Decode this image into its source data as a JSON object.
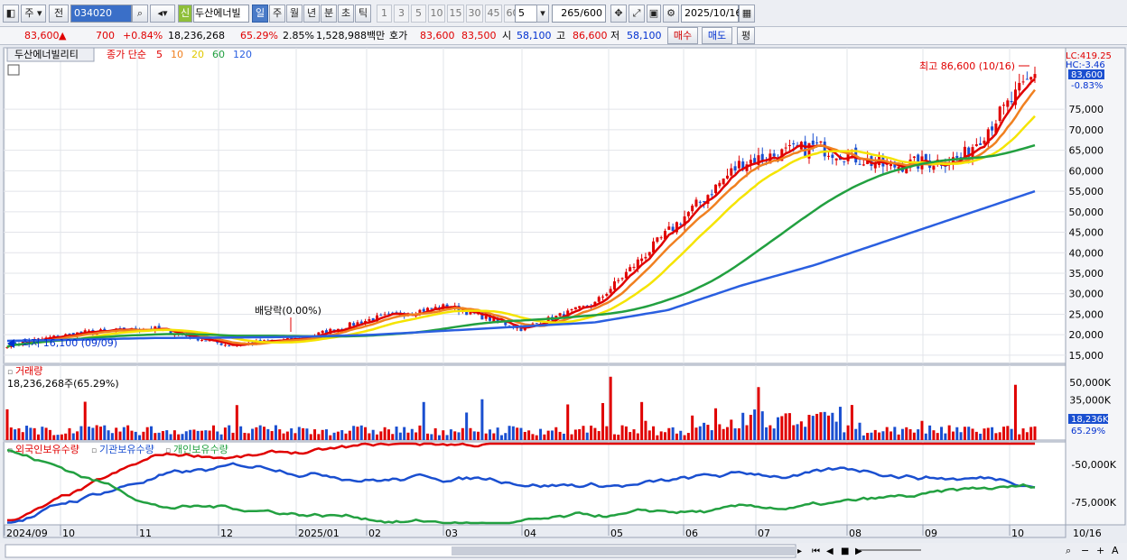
{
  "toolbar": {
    "market": "주",
    "prev_label": "전",
    "code": "034020",
    "new_badge": "신",
    "stock_name": "두산에너빌",
    "periods": [
      "일",
      "주",
      "월",
      "년",
      "분",
      "초",
      "틱"
    ],
    "active_period": "일",
    "intervals": [
      "1",
      "3",
      "5",
      "10",
      "15",
      "30",
      "45",
      "60"
    ],
    "interval_value": "5",
    "count": "265",
    "count_max": "/600",
    "date": "2025/10/16"
  },
  "quote": {
    "price": "83,600",
    "change_arrow": "▲",
    "change": "700",
    "change_pct": "+0.84%",
    "volume": "18,236,268",
    "vol_ratio": "65.29%",
    "turnover": "2.85%",
    "amount": "1,528,988백만",
    "hoga_label": "호가",
    "ask": "83,600",
    "bid": "83,500",
    "open_label": "시",
    "open": "58,100",
    "high_label": "고",
    "high": "86,600",
    "low_label": "저",
    "low": "58,100",
    "buy_label": "매수",
    "sell_label": "매도",
    "flat_label": "평"
  },
  "price_panel": {
    "title": "두산에너빌리티",
    "legend_prefix": "종가 단순",
    "ma_periods": [
      "5",
      "10",
      "20",
      "60",
      "120"
    ],
    "high_note": "최고 86,600 (10/16)",
    "low_note": "최저 16,100 (09/09)",
    "dividend_note": "배당락(0.00%)",
    "lc": "LC:419.25",
    "hc": "HC:-3.46",
    "last_price": "83,600",
    "last_pct": "-0.83%",
    "y_ticks": [
      "75,000",
      "70,000",
      "65,000",
      "60,000",
      "55,000",
      "50,000",
      "45,000",
      "40,000",
      "35,000",
      "30,000",
      "25,000",
      "20,000",
      "15,000"
    ]
  },
  "volume_panel": {
    "title": "거래량",
    "value": "18,236,268주(65.29%)",
    "y_ticks": [
      "50,000K",
      "35,000K"
    ],
    "last": "18,236K",
    "last_pct": "65.29%"
  },
  "holding_panel": {
    "series": [
      "외국인보유수량",
      "기관보유수량",
      "개인보유수량"
    ],
    "y_ticks": [
      "-50,000K",
      "-75,000K"
    ]
  },
  "x_axis": {
    "labels": [
      "2024/09",
      "10",
      "11",
      "12",
      "2025/01",
      "02",
      "03",
      "04",
      "05",
      "06",
      "07",
      "08",
      "09",
      "10"
    ],
    "end_label": "10/16"
  },
  "colors": {
    "up": "#e00000",
    "down": "#1a4fd0",
    "ma5": "#e00000",
    "ma10": "#f08020",
    "ma20": "#f5e400",
    "ma60": "#22a040",
    "ma120": "#2a5fe0"
  },
  "chart_data": [
    {
      "type": "candlestick",
      "title": "두산에너빌리티",
      "x": [
        "2024/09",
        "10",
        "11",
        "12",
        "2025/01",
        "02",
        "03",
        "04",
        "05",
        "06",
        "07",
        "08",
        "09",
        "10",
        "10/16"
      ],
      "close": [
        17500,
        20500,
        21500,
        17500,
        19000,
        24000,
        27000,
        21500,
        27500,
        45000,
        62000,
        66000,
        61000,
        63000,
        83600
      ],
      "ma120": [
        18500,
        18800,
        19200,
        19300,
        19500,
        20000,
        21000,
        22000,
        23000,
        26000,
        32000,
        37000,
        43000,
        49000,
        55000
      ],
      "ylim": [
        13000,
        90000
      ]
    },
    {
      "type": "bar",
      "title": "거래량",
      "ylim": [
        0,
        65000
      ]
    },
    {
      "type": "line",
      "series": [
        {
          "name": "외국인보유수량"
        },
        {
          "name": "기관보유수량"
        },
        {
          "name": "개인보유수량"
        }
      ],
      "ylim": [
        -90000,
        -35000
      ]
    }
  ]
}
